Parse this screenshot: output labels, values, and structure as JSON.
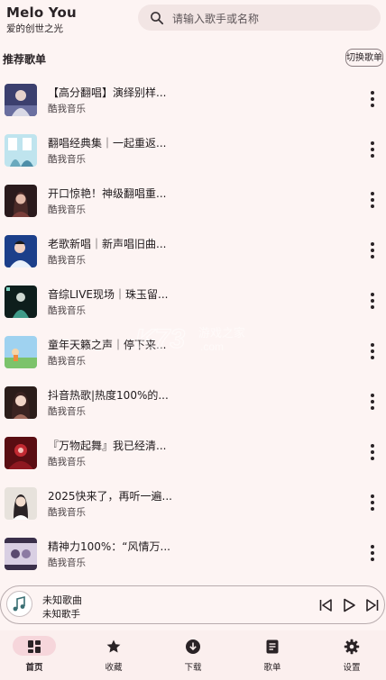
{
  "header": {
    "title": "Melo You",
    "subtitle": "爱的创世之光",
    "search_placeholder": "请输入歌手或名称",
    "search_icon": "search-icon"
  },
  "section": {
    "title": "推荐歌单",
    "switch_label": "切换歌单"
  },
  "playlists": [
    {
      "title": "【高分翻唱】演绎别样...",
      "source": "酷我音乐"
    },
    {
      "title": "翻唱经典集｜一起重返...",
      "source": "酷我音乐"
    },
    {
      "title": "开口惊艳！神级翻唱重...",
      "source": "酷我音乐"
    },
    {
      "title": "老歌新唱｜新声唱旧曲...",
      "source": "酷我音乐"
    },
    {
      "title": "音综LIVE现场｜珠玉留...",
      "source": "酷我音乐"
    },
    {
      "title": "童年天籁之声｜停下来...",
      "source": "酷我音乐"
    },
    {
      "title": "抖音热歌|热度100%的...",
      "source": "酷我音乐"
    },
    {
      "title": "『万物起舞』我已经清...",
      "source": "酷我音乐"
    },
    {
      "title": "2025快来了，再听一遍...",
      "source": "酷我音乐"
    },
    {
      "title": "精神力100%：“风情万...",
      "source": "酷我音乐"
    }
  ],
  "player": {
    "song": "未知歌曲",
    "artist": "未知歌手"
  },
  "nav": [
    {
      "label": "首页",
      "icon": "home-icon",
      "active": true
    },
    {
      "label": "收藏",
      "icon": "star-icon",
      "active": false
    },
    {
      "label": "下载",
      "icon": "download-icon",
      "active": false
    },
    {
      "label": "歌单",
      "icon": "playlist-icon",
      "active": false
    },
    {
      "label": "设置",
      "icon": "gear-icon",
      "active": false
    }
  ],
  "colors": {
    "background": "#fdf4f3",
    "search_bg": "#f2e5e4",
    "nav_active": "#f6d6db"
  }
}
